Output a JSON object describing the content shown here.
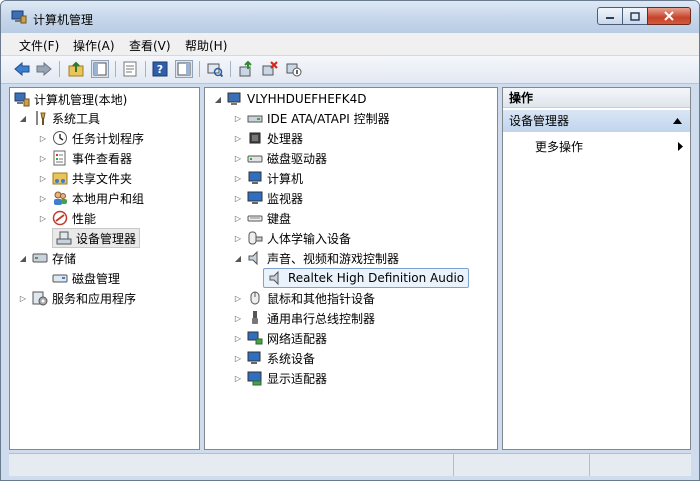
{
  "window": {
    "title": "计算机管理"
  },
  "menu": [
    "文件(F)",
    "操作(A)",
    "查看(V)",
    "帮助(H)"
  ],
  "left_tree": {
    "root": "计算机管理(本地)",
    "system_tools": "系统工具",
    "task_scheduler": "任务计划程序",
    "event_viewer": "事件查看器",
    "shared_folders": "共享文件夹",
    "local_users": "本地用户和组",
    "performance": "性能",
    "device_manager": "设备管理器",
    "storage": "存储",
    "disk_management": "磁盘管理",
    "services_apps": "服务和应用程序"
  },
  "device_tree": {
    "computer": "VLYHHDUEFHEFK4D",
    "ide": "IDE ATA/ATAPI 控制器",
    "processor": "处理器",
    "disk_drives": "磁盘驱动器",
    "computer_node": "计算机",
    "monitors": "监视器",
    "keyboards": "键盘",
    "hid": "人体学输入设备",
    "sound": "声音、视频和游戏控制器",
    "realtek": "Realtek High Definition Audio",
    "mice": "鼠标和其他指针设备",
    "usb": "通用串行总线控制器",
    "network": "网络适配器",
    "system_devices": "系统设备",
    "display": "显示适配器"
  },
  "actions": {
    "header": "操作",
    "section": "设备管理器",
    "more": "更多操作"
  }
}
